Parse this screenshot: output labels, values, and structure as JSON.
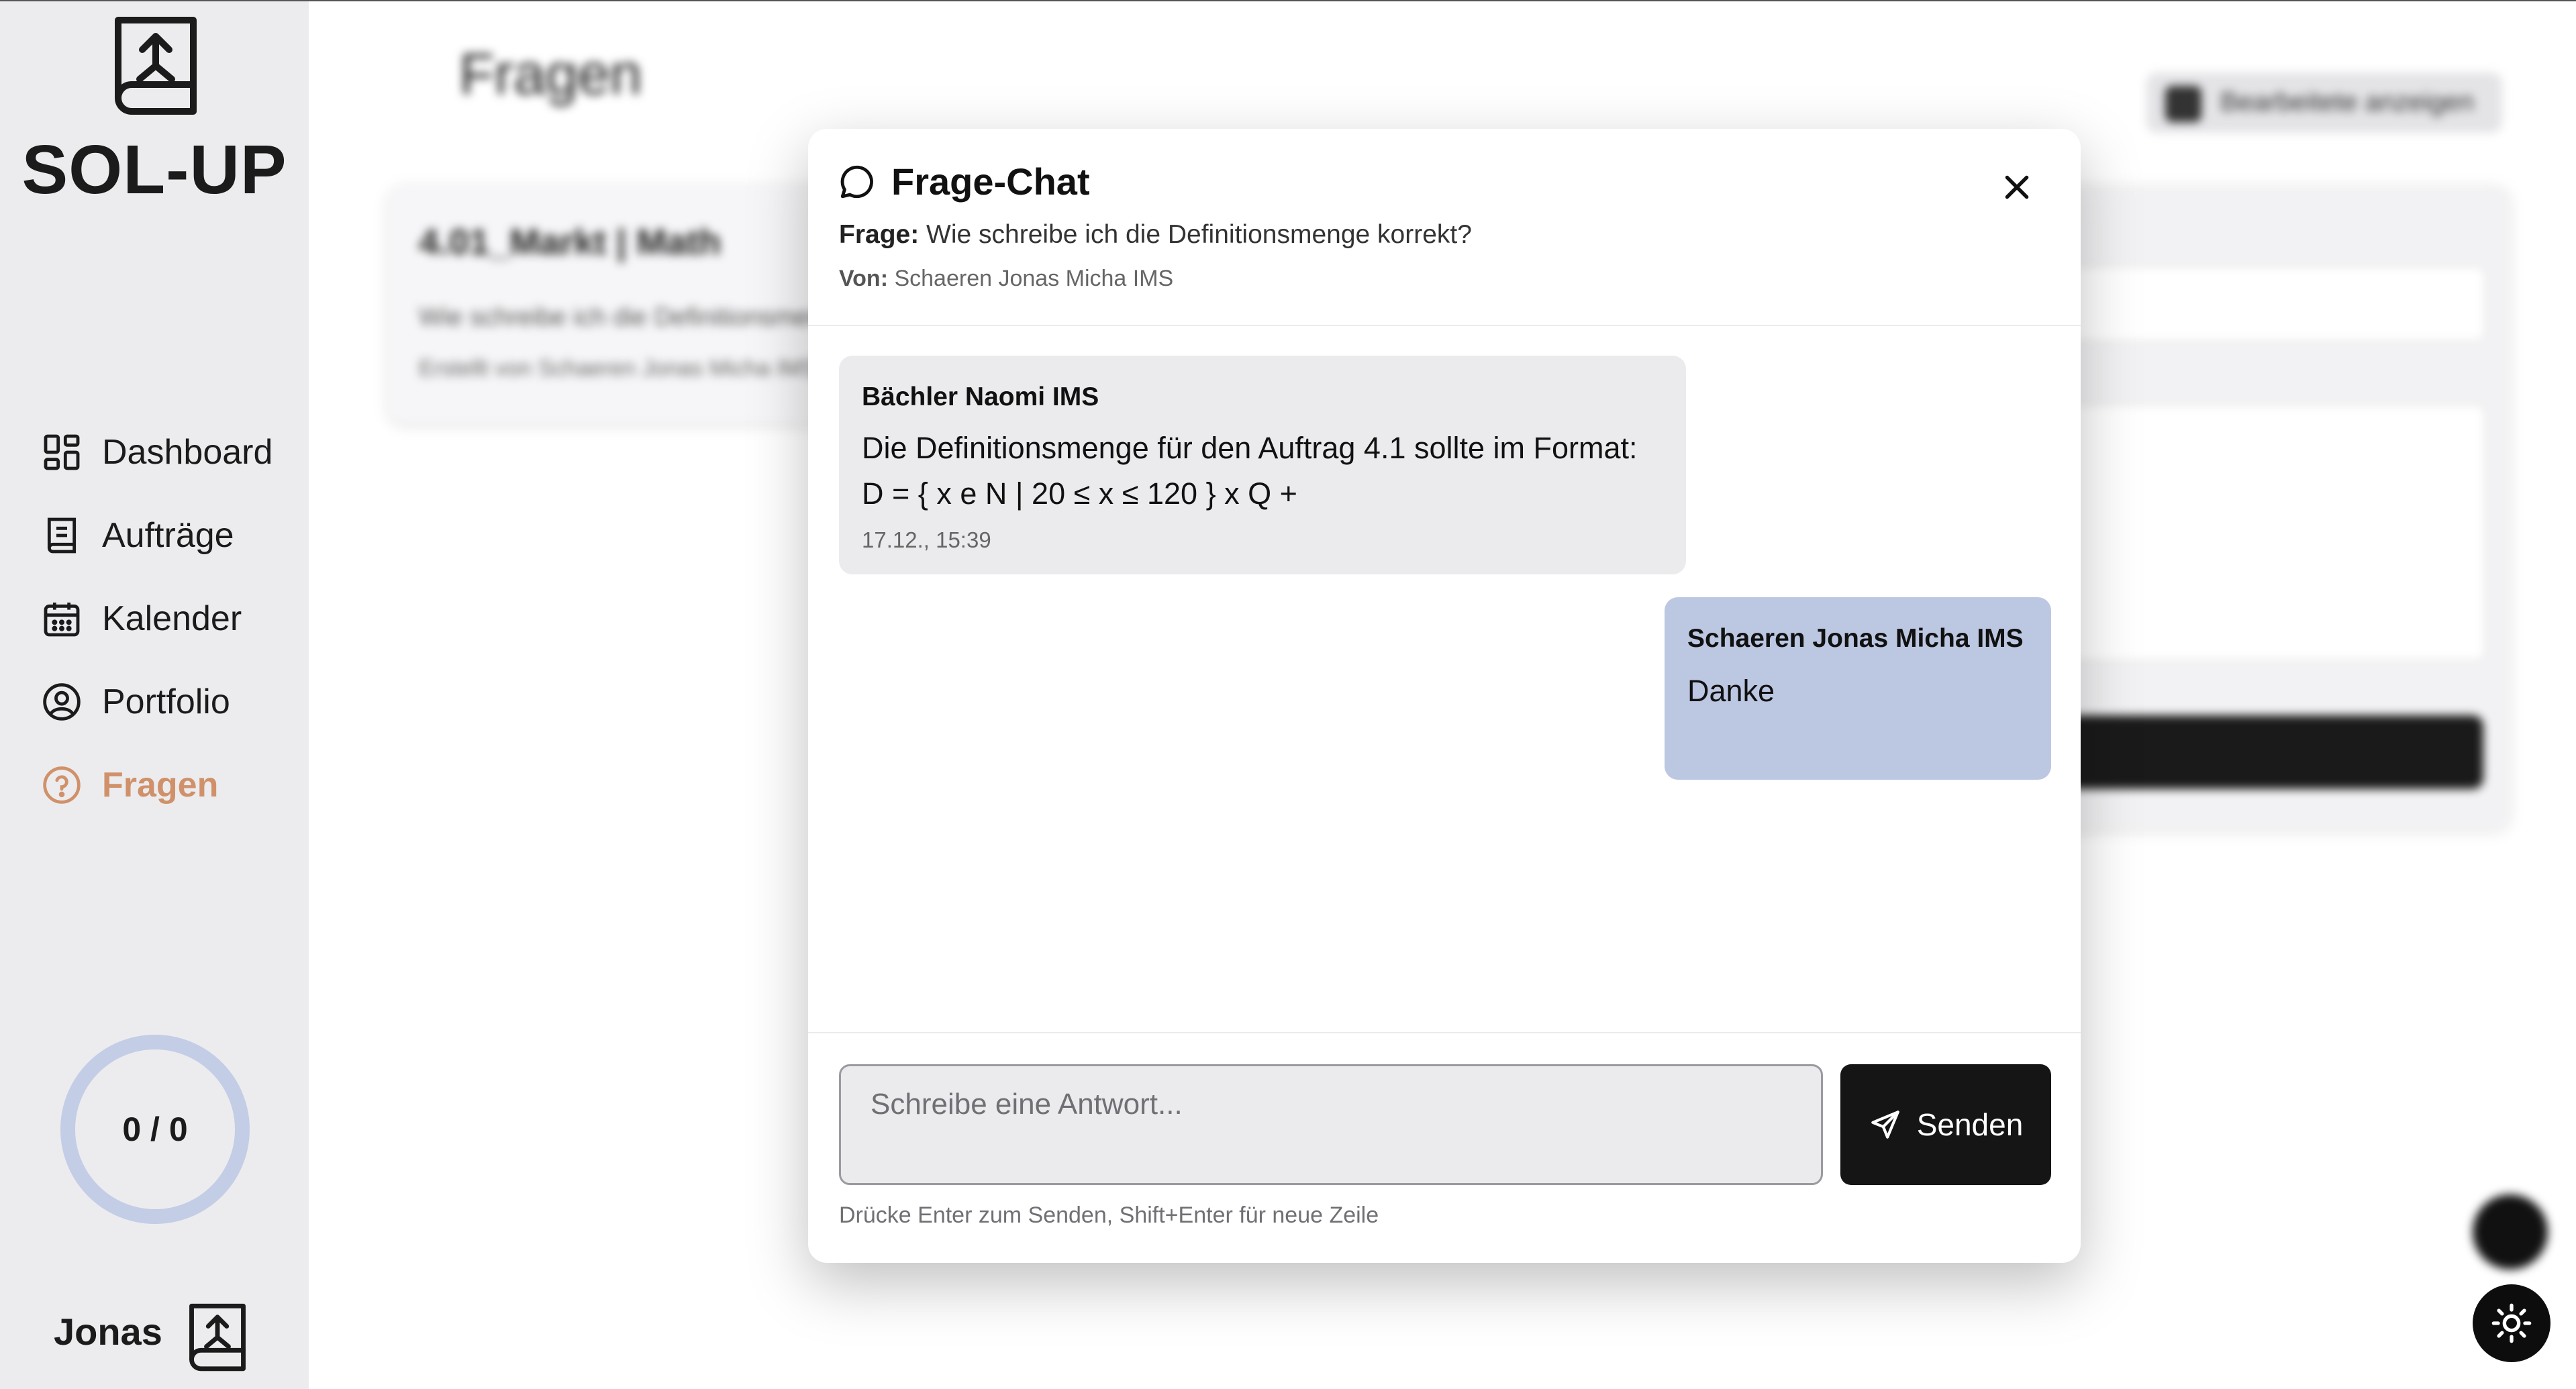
{
  "app": {
    "name": "SOL-UP"
  },
  "sidebar": {
    "items": [
      {
        "label": "Dashboard",
        "icon": "dashboard-icon"
      },
      {
        "label": "Aufträge",
        "icon": "book-icon"
      },
      {
        "label": "Kalender",
        "icon": "calendar-icon"
      },
      {
        "label": "Portfolio",
        "icon": "user-circle-icon"
      },
      {
        "label": "Fragen",
        "icon": "question-circle-icon",
        "active": true
      }
    ],
    "progress": {
      "text": "0 / 0",
      "done": 0,
      "total": 0
    },
    "user": {
      "name": "Jonas"
    }
  },
  "background": {
    "page_title": "Fragen",
    "toggle_label": "Bearbeitete anzeigen",
    "card": {
      "title": "4.01_Markt | Math",
      "question": "Wie schreibe ich die Definitionsmenge",
      "byline": "Erstellt von Schaeren Jonas Micha IMS"
    }
  },
  "modal": {
    "title": "Frage-Chat",
    "question_label": "Frage:",
    "question_text": "Wie schreibe ich die Definitionsmenge korrekt?",
    "from_label": "Von:",
    "from_text": "Schaeren Jonas Micha IMS",
    "messages": [
      {
        "author": "Bächler Naomi IMS",
        "line1": "Die Definitionsmenge für den Auftrag 4.1 sollte im Format:",
        "line2": "D = { x e N | 20 ≤ x ≤ 120 } x Q +",
        "time": "17.12., 15:39"
      },
      {
        "author": "Schaeren Jonas Micha IMS",
        "line1": "Danke"
      }
    ],
    "reply_placeholder": "Schreibe eine Antwort...",
    "send_label": "Senden",
    "hint": "Drücke Enter zum Senden, Shift+Enter für neue Zeile"
  },
  "colors": {
    "accent": "#d0916a",
    "sidebar_bg": "#ececef",
    "own_message_bg": "#bcc7e2",
    "other_message_bg": "#ebebee",
    "progress_ring": "#c3cde6",
    "button_dark": "#151515"
  }
}
